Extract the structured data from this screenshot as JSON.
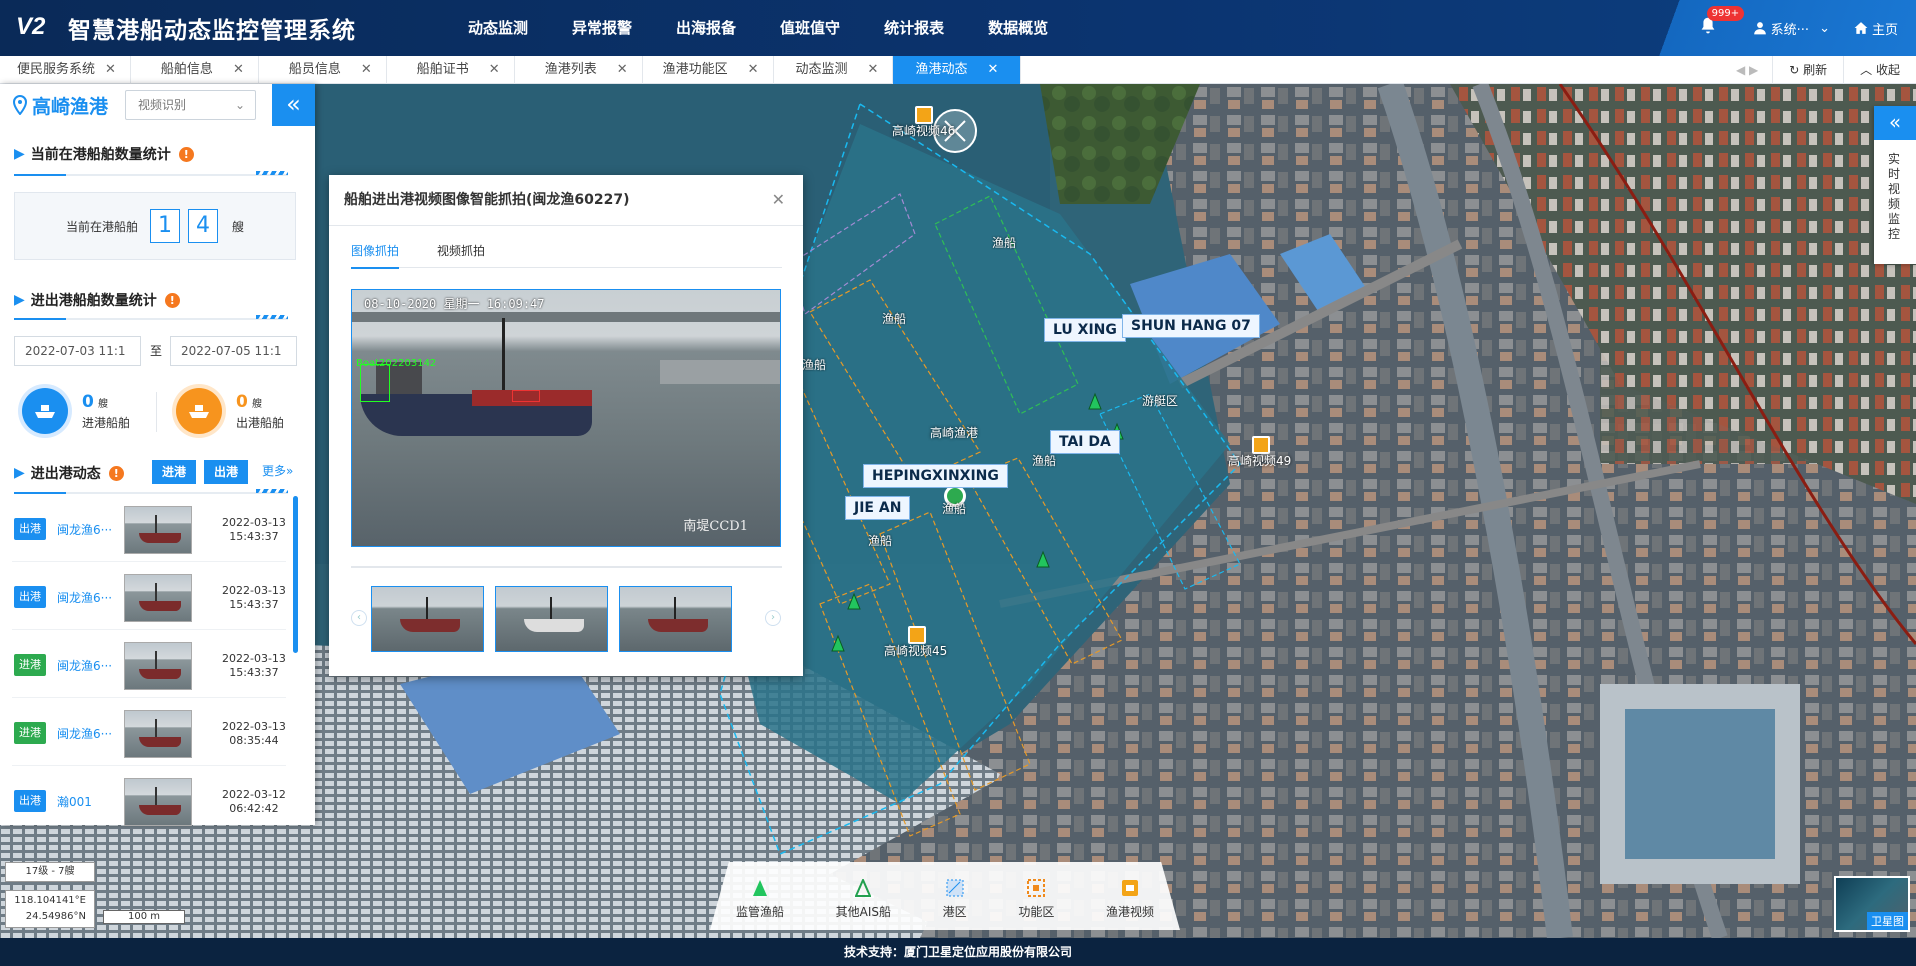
{
  "header": {
    "logo": "V2",
    "title": "智慧港船动态监控管理系统",
    "nav": [
      "动态监测",
      "异常报警",
      "出海报备",
      "值班值守",
      "统计报表",
      "数据概览"
    ],
    "badge": "999+",
    "user": "系统···",
    "home": "主页"
  },
  "tabs": [
    "便民服务系统",
    "船舶信息",
    "船员信息",
    "船舶证书",
    "渔港列表",
    "渔港功能区",
    "动态监测",
    "渔港动态"
  ],
  "tab_tools": {
    "arrows": "◀ ▶",
    "refresh": "刷新",
    "collapse": "收起"
  },
  "left_panel": {
    "port_name": "高崎渔港",
    "select_value": "视频识别",
    "current_title": "当前在港船舶数量统计",
    "current_label": "当前在港船舶",
    "digits": [
      "1",
      "4"
    ],
    "unit": "艘",
    "inout_title": "进出港船舶数量统计",
    "date_from": "2022-07-03 11:1",
    "date_to": "2022-07-05 11:1",
    "to": "至",
    "in_count": "0",
    "in_unit": "艘",
    "in_label": "进港船舶",
    "out_count": "0",
    "out_unit": "艘",
    "out_label": "出港船舶",
    "dynamic_title": "进出港动态",
    "btn_in": "进港",
    "btn_out": "出港",
    "more": "更多»",
    "rows": [
      {
        "tag": "出港",
        "type": "out",
        "name": "闽龙渔6···",
        "date": "2022-03-13",
        "time": "15:43:37"
      },
      {
        "tag": "出港",
        "type": "out",
        "name": "闽龙渔6···",
        "date": "2022-03-13",
        "time": "15:43:37"
      },
      {
        "tag": "进港",
        "type": "in",
        "name": "闽龙渔6···",
        "date": "2022-03-13",
        "time": "15:43:37"
      },
      {
        "tag": "进港",
        "type": "in",
        "name": "闽龙渔6···",
        "date": "2022-03-13",
        "time": "08:35:44"
      },
      {
        "tag": "出港",
        "type": "out",
        "name": "瀚001",
        "date": "2022-03-12",
        "time": "06:42:42"
      }
    ]
  },
  "popup": {
    "title": "船舶进出港视频图像智能抓拍(闽龙渔60227)",
    "tab_image": "图像抓拍",
    "tab_video": "视频抓拍",
    "timestamp": "08-10-2020 星期一 16:09:47",
    "detection": "Boat202203142",
    "camera": "南堤CCD1"
  },
  "map": {
    "vessels": [
      "LU XING",
      "SHUN HANG 07",
      "TAI DA",
      "HEPINGXINXING",
      "JIE AN"
    ],
    "zones": [
      "渔船",
      "渔船",
      "渔船",
      "渔船",
      "渔船",
      "渔船",
      "游艇区"
    ],
    "cameras": [
      "高崎视频46",
      "高崎视频49",
      "高崎视频45"
    ],
    "port_label": "高崎渔港",
    "right_panel": "实时视频监控",
    "legend": [
      "监管渔船",
      "其他AIS船",
      "港区",
      "功能区",
      "渔港视频"
    ],
    "zoom": "17级 - 7艘",
    "coord_e": "118.104141°E",
    "coord_n": "24.54986°N",
    "scale": "100 m",
    "sat": "卫星图"
  },
  "footer": "技术支持：厦门卫星定位应用股份有限公司",
  "colors": {
    "accent": "#1a8ff0",
    "header": "#0b3470",
    "in": "#2daa4f",
    "warn": "#f5781f"
  }
}
